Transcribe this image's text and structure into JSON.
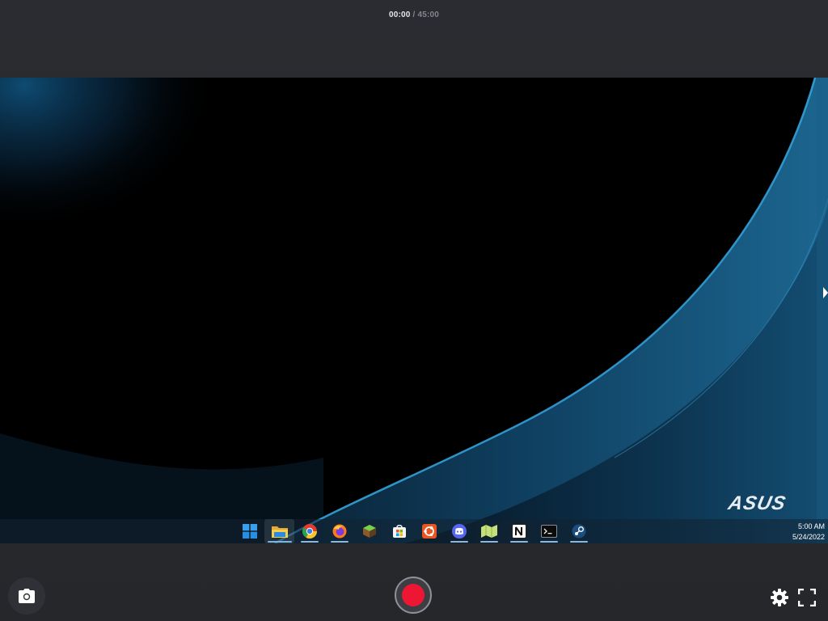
{
  "recorder": {
    "elapsed": "00:00",
    "separator": " / ",
    "total": "45:00",
    "record_color": "#ee1733"
  },
  "desktop": {
    "brand_logo": "ASUS",
    "wallpaper_accent": "#2a9fd6",
    "taskbar": {
      "apps": [
        {
          "name": "start-icon",
          "active": false,
          "running": false
        },
        {
          "name": "file-explorer-icon",
          "active": true,
          "running": true
        },
        {
          "name": "chrome-icon",
          "active": false,
          "running": true
        },
        {
          "name": "firefox-icon",
          "active": false,
          "running": true
        },
        {
          "name": "minecraft-icon",
          "active": false,
          "running": false
        },
        {
          "name": "microsoft-store-icon",
          "active": false,
          "running": false
        },
        {
          "name": "ubuntu-icon",
          "active": false,
          "running": false
        },
        {
          "name": "discord-icon",
          "active": false,
          "running": true
        },
        {
          "name": "map-icon",
          "active": false,
          "running": true
        },
        {
          "name": "notion-icon",
          "active": false,
          "running": true
        },
        {
          "name": "terminal-icon",
          "active": false,
          "running": true
        },
        {
          "name": "steam-icon",
          "active": false,
          "running": true
        }
      ],
      "clock_time": "5:00 AM",
      "clock_date": "5/24/2022"
    }
  },
  "controls": {
    "screenshot_icon": "camera-icon",
    "settings_icon": "gear-icon",
    "fullscreen_icon": "fullscreen-icon"
  }
}
